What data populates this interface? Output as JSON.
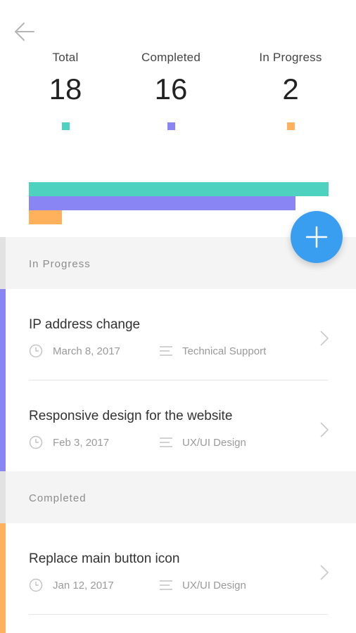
{
  "stats": [
    {
      "label": "Total",
      "value": "18",
      "color": "#4fd1c0"
    },
    {
      "label": "Completed",
      "value": "16",
      "color": "#8a85f5"
    },
    {
      "label": "In Progress",
      "value": "2",
      "color": "#ffb15c"
    }
  ],
  "bars": {
    "max": 18,
    "items": [
      {
        "name": "Total",
        "value": 18,
        "color": "#4fd1c0"
      },
      {
        "name": "Completed",
        "value": 16,
        "color": "#8a85f5"
      },
      {
        "name": "In Progress",
        "value": 2,
        "color": "#ffb15c"
      }
    ]
  },
  "sections": {
    "in_progress": {
      "title": "In Progress",
      "accent": "#8a85f5",
      "tasks": [
        {
          "title": "IP address change",
          "date": "March 8, 2017",
          "category": "Technical Support"
        },
        {
          "title": "Responsive design for the website",
          "date": "Feb 3, 2017",
          "category": "UX/UI Design"
        }
      ]
    },
    "completed": {
      "title": "Completed",
      "accent": "#ffb15c",
      "tasks": [
        {
          "title": "Replace main button icon",
          "date": "Jan 12, 2017",
          "category": "UX/UI Design"
        }
      ]
    }
  },
  "icons": {
    "back": "arrow-left-icon",
    "add": "plus-icon",
    "date": "clock-icon",
    "category": "lines-icon",
    "open": "chevron-right-icon"
  },
  "colors": {
    "fab": "#3a9ef0",
    "section_bg": "#f4f4f4"
  }
}
